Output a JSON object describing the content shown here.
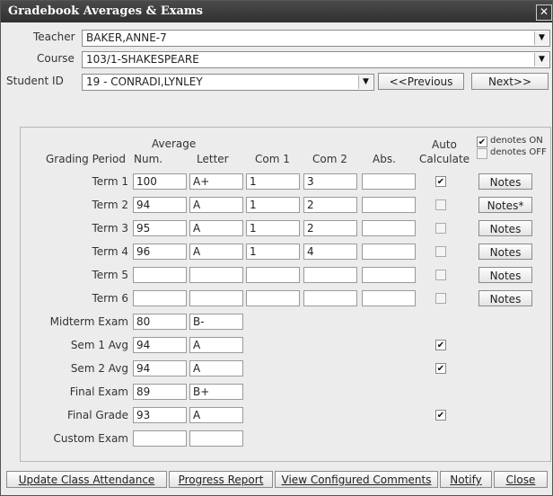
{
  "window": {
    "title": "Gradebook Averages & Exams",
    "close_glyph": "✕"
  },
  "header": {
    "teacher_label": "Teacher",
    "teacher_value": "BAKER,ANNE-7",
    "course_label": "Course",
    "course_value": "103/1-SHAKESPEARE",
    "student_label": "Student ID",
    "student_value": "19 - CONRADI,LYNLEY",
    "prev_label": "<<Previous",
    "next_label": "Next>>"
  },
  "columns": {
    "average": "Average",
    "grading_period": "Grading Period",
    "num": "Num.",
    "letter": "Letter",
    "com1": "Com 1",
    "com2": "Com 2",
    "abs": "Abs.",
    "auto": "Auto",
    "calculate": "Calculate"
  },
  "legend": {
    "on": "denotes ON",
    "off": "denotes OFF"
  },
  "terms": [
    {
      "label": "Term 1",
      "num": "100",
      "letter": "A+",
      "com1": "1",
      "com2": "3",
      "abs": "",
      "auto": true,
      "notes": "Notes"
    },
    {
      "label": "Term 2",
      "num": "94",
      "letter": "A",
      "com1": "1",
      "com2": "2",
      "abs": "",
      "auto": false,
      "notes": "Notes*"
    },
    {
      "label": "Term 3",
      "num": "95",
      "letter": "A",
      "com1": "1",
      "com2": "2",
      "abs": "",
      "auto": false,
      "notes": "Notes"
    },
    {
      "label": "Term 4",
      "num": "96",
      "letter": "A",
      "com1": "1",
      "com2": "4",
      "abs": "",
      "auto": false,
      "notes": "Notes"
    },
    {
      "label": "Term 5",
      "num": "",
      "letter": "",
      "com1": "",
      "com2": "",
      "abs": "",
      "auto": false,
      "notes": "Notes"
    },
    {
      "label": "Term 6",
      "num": "",
      "letter": "",
      "com1": "",
      "com2": "",
      "abs": "",
      "auto": false,
      "notes": "Notes"
    }
  ],
  "summary": [
    {
      "label": "Midterm Exam",
      "num": "80",
      "letter": "B-",
      "auto": null
    },
    {
      "label": "Sem 1 Avg",
      "num": "94",
      "letter": "A",
      "auto": true
    },
    {
      "label": "Sem 2 Avg",
      "num": "94",
      "letter": "A",
      "auto": true
    },
    {
      "label": "Final Exam",
      "num": "89",
      "letter": "B+",
      "auto": null
    },
    {
      "label": "Final Grade",
      "num": "93",
      "letter": "A",
      "auto": true
    },
    {
      "label": "Custom Exam",
      "num": "",
      "letter": "",
      "auto": null
    }
  ],
  "footer": {
    "update_attendance": "Update Class Attendance",
    "progress_report": "Progress Report",
    "view_comments": "View Configured Comments",
    "notify": "Notify",
    "close": "Close"
  },
  "check_glyph": "✔",
  "dropdown_glyph": "▼"
}
